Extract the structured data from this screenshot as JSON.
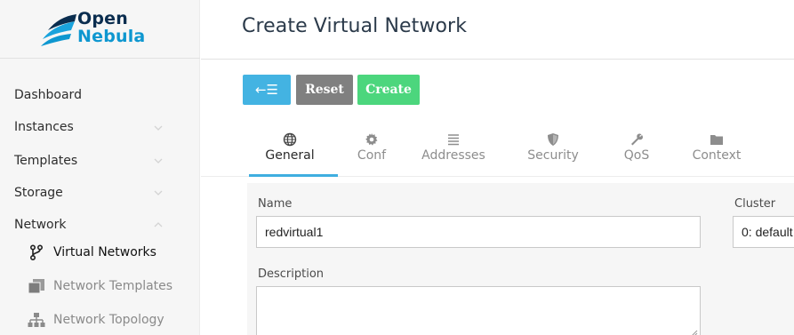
{
  "brand": {
    "line1": "Open",
    "line2": "Nebula"
  },
  "sidebar": {
    "items": [
      {
        "label": "Dashboard"
      },
      {
        "label": "Instances"
      },
      {
        "label": "Templates"
      },
      {
        "label": "Storage"
      },
      {
        "label": "Network"
      }
    ],
    "network_sub": [
      {
        "label": "Virtual Networks",
        "icon": "fork-icon"
      },
      {
        "label": "Network Templates",
        "icon": "stacked-pages-icon"
      },
      {
        "label": "Network Topology",
        "icon": "topology-icon"
      }
    ]
  },
  "page": {
    "title": "Create Virtual Network"
  },
  "toolbar": {
    "back_label": "←☰",
    "reset_label": "Reset",
    "create_label": "Create"
  },
  "tabs": [
    {
      "label": "General",
      "icon": "globe-icon"
    },
    {
      "label": "Conf",
      "icon": "gear-icon"
    },
    {
      "label": "Addresses",
      "icon": "list-icon"
    },
    {
      "label": "Security",
      "icon": "shield-icon"
    },
    {
      "label": "QoS",
      "icon": "wrench-icon"
    },
    {
      "label": "Context",
      "icon": "folder-icon"
    }
  ],
  "form": {
    "name_label": "Name",
    "name_value": "redvirtual1",
    "cluster_label": "Cluster",
    "cluster_value": "0: default",
    "description_label": "Description",
    "description_value": ""
  },
  "colors": {
    "back_button": "#43b3e2",
    "reset_button": "#808080",
    "create_button": "#4cd67d",
    "tab_accent": "#3faee0",
    "brand_dark": "#0a2d4f",
    "brand_blue": "#0e97d0"
  }
}
